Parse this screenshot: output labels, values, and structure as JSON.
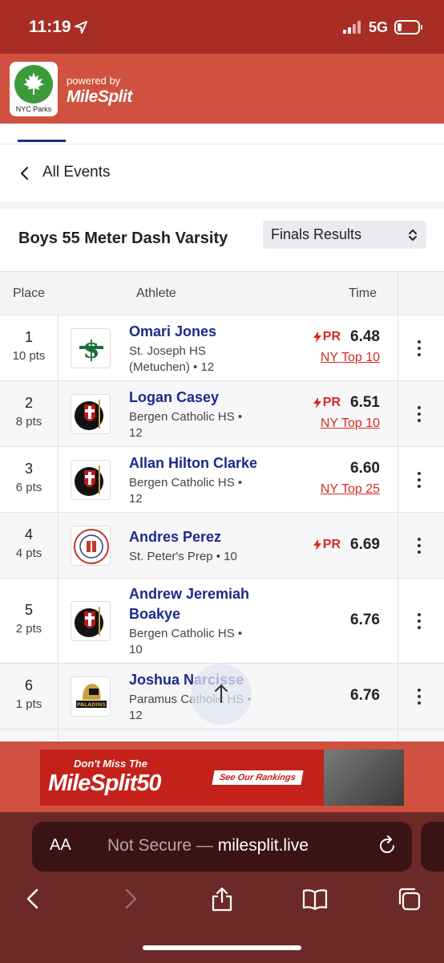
{
  "status_bar": {
    "time": "11:19",
    "network": "5G",
    "location_icon": "location-arrow-icon",
    "signal_icon": "cellular-signal-icon",
    "battery_icon": "battery-low-icon",
    "battery_level": 0.2
  },
  "header": {
    "logo_text": "NYC Parks",
    "powered_by": "powered by",
    "brand": "MileSplit"
  },
  "nav": {
    "back_label": "All Events"
  },
  "event": {
    "title": "Boys 55 Meter Dash Varsity",
    "results_select": "Finals Results"
  },
  "table": {
    "headers": {
      "place": "Place",
      "athlete": "Athlete",
      "time": "Time"
    },
    "pr_label": "PR",
    "rows": [
      {
        "place": "1",
        "points": "10 pts",
        "name_lines": [
          "Omari Jones"
        ],
        "school_lines": [
          "St. Joseph HS",
          "(Metuchen) • 12"
        ],
        "pr": true,
        "time": "6.48",
        "rank_link": "NY Top 10",
        "logo": "st-joseph-logo"
      },
      {
        "place": "2",
        "points": "8 pts",
        "name_lines": [
          "Logan Casey"
        ],
        "school_lines": [
          "Bergen Catholic HS •",
          "12"
        ],
        "pr": true,
        "time": "6.51",
        "rank_link": "NY Top 10",
        "logo": "bergen-catholic-logo"
      },
      {
        "place": "3",
        "points": "6 pts",
        "name_lines": [
          "Allan Hilton Clarke"
        ],
        "school_lines": [
          "Bergen Catholic HS •",
          "12"
        ],
        "pr": false,
        "time": "6.60",
        "rank_link": "NY Top 25",
        "logo": "bergen-catholic-logo"
      },
      {
        "place": "4",
        "points": "4 pts",
        "name_lines": [
          "Andres Perez"
        ],
        "school_lines": [
          "St. Peter's Prep • 10"
        ],
        "pr": true,
        "time": "6.69",
        "rank_link": "",
        "logo": "st-peters-prep-logo"
      },
      {
        "place": "5",
        "points": "2 pts",
        "name_lines": [
          "Andrew Jeremiah",
          "Boakye"
        ],
        "school_lines": [
          "Bergen Catholic HS •",
          "10"
        ],
        "pr": false,
        "time": "6.76",
        "rank_link": "",
        "logo": "bergen-catholic-logo"
      },
      {
        "place": "6",
        "points": "1 pts",
        "name_lines": [
          "Joshua Narcisse"
        ],
        "school_lines": [
          "Paramus Catholic HS •",
          "12"
        ],
        "pr": false,
        "time": "6.76",
        "rank_link": "",
        "logo": "paramus-catholic-logo"
      }
    ]
  },
  "ad": {
    "line1": "Don't Miss The",
    "line2": "MileSplit50",
    "cta": "See Our Rankings"
  },
  "browser": {
    "aa": "AA",
    "url_prefix": "Not Secure — ",
    "url_host": "milesplit.live"
  },
  "colors": {
    "status_bar": "#a82d25",
    "header": "#d0513f",
    "link_navy": "#1c2a8a",
    "accent_red": "#d62b22",
    "browser_chrome": "#6b2a28"
  }
}
